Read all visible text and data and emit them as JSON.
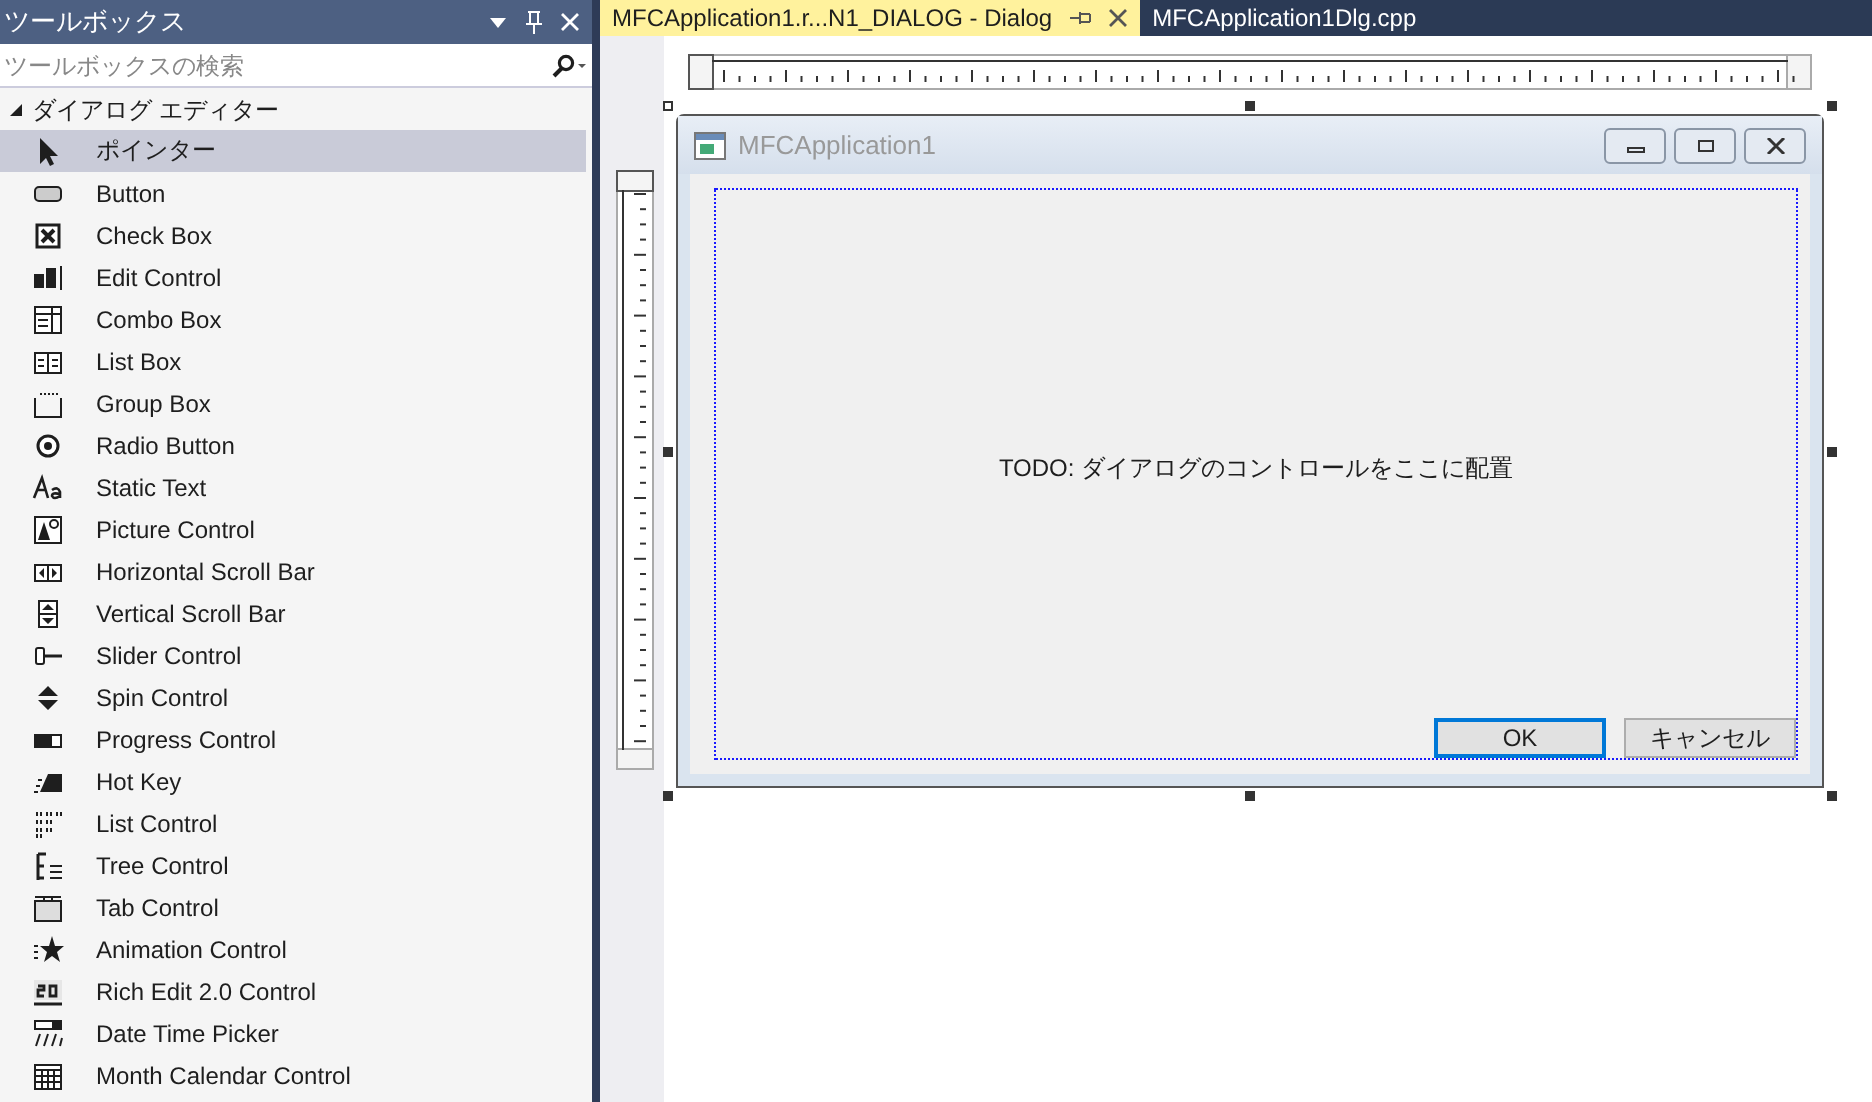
{
  "toolbox": {
    "title": "ツールボックス",
    "search": {
      "placeholder": "ツールボックスの検索"
    },
    "group": {
      "label": "ダイアログ エディター",
      "expanded": true
    },
    "items": [
      {
        "label": "ポインター",
        "selected": true
      },
      {
        "label": "Button",
        "selected": false
      },
      {
        "label": "Check Box",
        "selected": false
      },
      {
        "label": "Edit Control",
        "selected": false
      },
      {
        "label": "Combo Box",
        "selected": false
      },
      {
        "label": "List Box",
        "selected": false
      },
      {
        "label": "Group Box",
        "selected": false
      },
      {
        "label": "Radio Button",
        "selected": false
      },
      {
        "label": "Static Text",
        "selected": false
      },
      {
        "label": "Picture Control",
        "selected": false
      },
      {
        "label": "Horizontal Scroll Bar",
        "selected": false
      },
      {
        "label": "Vertical Scroll Bar",
        "selected": false
      },
      {
        "label": "Slider Control",
        "selected": false
      },
      {
        "label": "Spin Control",
        "selected": false
      },
      {
        "label": "Progress Control",
        "selected": false
      },
      {
        "label": "Hot Key",
        "selected": false
      },
      {
        "label": "List Control",
        "selected": false
      },
      {
        "label": "Tree Control",
        "selected": false
      },
      {
        "label": "Tab Control",
        "selected": false
      },
      {
        "label": "Animation Control",
        "selected": false
      },
      {
        "label": "Rich Edit 2.0 Control",
        "selected": false
      },
      {
        "label": "Date Time Picker",
        "selected": false
      },
      {
        "label": "Month Calendar Control",
        "selected": false
      }
    ]
  },
  "tabs": [
    {
      "label": "MFCApplication1.r...N1_DIALOG - Dialog",
      "selected": true
    },
    {
      "label": "MFCApplication1Dlg.cpp",
      "selected": false
    }
  ],
  "dialog": {
    "title": "MFCApplication1",
    "message": "TODO: ダイアログのコントロールをここに配置",
    "buttons": [
      {
        "label": "OK",
        "selected": true
      },
      {
        "label": "キャンセル",
        "selected": false
      }
    ]
  }
}
